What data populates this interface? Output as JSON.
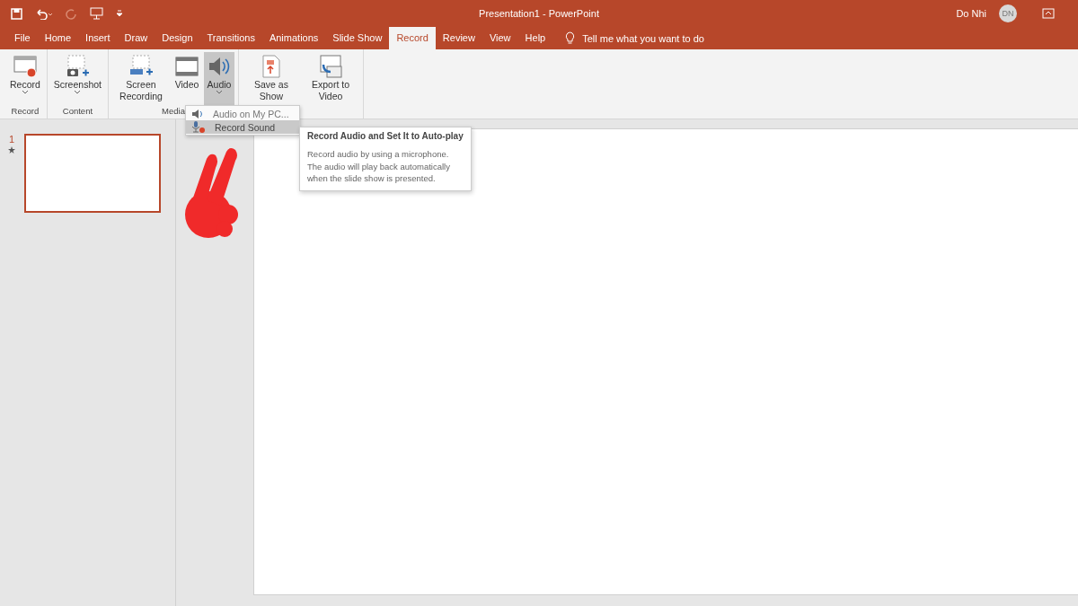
{
  "window": {
    "title": "Presentation1  -  PowerPoint",
    "user": "Do Nhi",
    "avatar": "DN"
  },
  "tabs": [
    {
      "label": "File",
      "selected": false
    },
    {
      "label": "Home",
      "selected": false
    },
    {
      "label": "Insert",
      "selected": false
    },
    {
      "label": "Draw",
      "selected": false
    },
    {
      "label": "Design",
      "selected": false
    },
    {
      "label": "Transitions",
      "selected": false
    },
    {
      "label": "Animations",
      "selected": false
    },
    {
      "label": "Slide Show",
      "selected": false
    },
    {
      "label": "Record",
      "selected": true
    },
    {
      "label": "Review",
      "selected": false
    },
    {
      "label": "View",
      "selected": false
    },
    {
      "label": "Help",
      "selected": false
    }
  ],
  "tell_me": {
    "placeholder": "Tell me what you want to do"
  },
  "ribbon_groups": [
    {
      "label": "Record",
      "commands": [
        {
          "kind": "record",
          "label": "Record",
          "dropdown": true,
          "selected": false
        }
      ]
    },
    {
      "label": "Content",
      "commands": [
        {
          "kind": "screenshot",
          "label": "Screenshot",
          "dropdown": true,
          "selected": false
        }
      ]
    },
    {
      "label": "Media",
      "commands": [
        {
          "kind": "screen",
          "label": "Screen Recording",
          "dropdown": false,
          "selected": false
        },
        {
          "kind": "video",
          "label": "Video",
          "dropdown": false,
          "selected": false
        },
        {
          "kind": "audio",
          "label": "Audio",
          "dropdown": true,
          "selected": true
        }
      ]
    },
    {
      "commands": [
        {
          "kind": "saveshow",
          "label": "Save as Show",
          "dropdown": false,
          "selected": false
        },
        {
          "kind": "export",
          "label": "Export to Video",
          "dropdown": false,
          "selected": false
        }
      ]
    }
  ],
  "audio_menu": [
    {
      "kind": "speaker",
      "label": "Audio on My PC...",
      "selected": false
    },
    {
      "kind": "mic",
      "label": "Record Sound",
      "selected": true
    }
  ],
  "tooltip": {
    "title": "Record Audio and Set It to Auto-play",
    "body": "Record audio by using a microphone. The audio will play back automatically when the slide show is presented."
  },
  "slides": [
    {
      "number": "1",
      "starred": true,
      "selected": true
    }
  ]
}
